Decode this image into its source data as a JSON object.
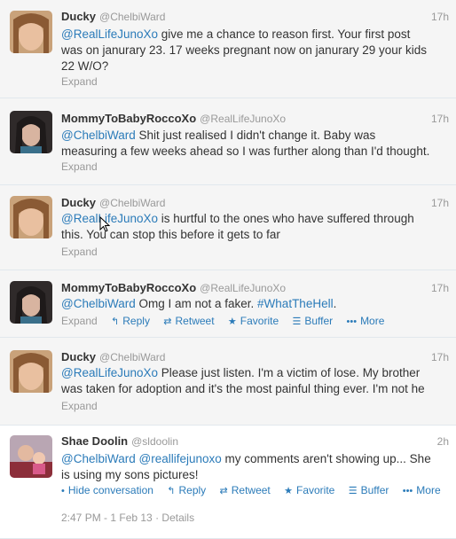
{
  "tweets": [
    {
      "name": "Ducky",
      "handle": "@ChelbiWard",
      "time": "17h",
      "mention": "@RealLifeJunoXo",
      "line1_rest": " give me a chance to reason first. Your first post",
      "line2": "was on janurary 23. 17 weeks pregnant now on janurary 29 your kids",
      "line3": "22 W/O?",
      "expand": "Expand"
    },
    {
      "name": "MommyToBabyRoccoXo",
      "handle": "@RealLifeJunoXo",
      "time": "17h",
      "mention": "@ChelbiWard",
      "line1_rest": " Shit just realised I didn't change it. Baby was",
      "line2": "measuring a few weeks ahead so I was further along than I'd thought.",
      "expand": "Expand"
    },
    {
      "name": "Ducky",
      "handle": "@ChelbiWard",
      "time": "17h",
      "mention": "@RealLifeJunoXo",
      "line1_rest": " is hurtful to the ones who have suffered through",
      "line2": "this. You can stop this before it gets to far",
      "expand": "Expand"
    },
    {
      "name": "MommyToBabyRoccoXo",
      "handle": "@RealLifeJunoXo",
      "time": "17h",
      "mention": "@ChelbiWard",
      "line1_middle": " Omg I am not a faker. ",
      "hashtag": "#WhatTheHell",
      "line1_end": ".",
      "actions": {
        "expand": "Expand",
        "reply": "Reply",
        "retweet": "Retweet",
        "favorite": "Favorite",
        "buffer": "Buffer",
        "more": "More"
      }
    },
    {
      "name": "Ducky",
      "handle": "@ChelbiWard",
      "time": "17h",
      "mention": "@RealLifeJunoXo",
      "line1_rest": " Please just listen. I'm a victim of lose. My brother",
      "line2": "was taken for adoption and it's the most painful thing ever. I'm not he",
      "expand": "Expand"
    },
    {
      "name": "Shae Doolin",
      "handle": "@sldoolin",
      "time": "2h",
      "mention": "@ChelbiWard",
      "mention2": "@reallifejunoxo",
      "line1_rest": " my comments aren't showing up... She",
      "line2": "is using my sons pictures!",
      "actions": {
        "hide": "Hide conversation",
        "reply": "Reply",
        "retweet": "Retweet",
        "favorite": "Favorite",
        "buffer": "Buffer",
        "more": "More"
      },
      "timestamp": "2:47 PM - 1 Feb 13",
      "separator": "·",
      "details": "Details"
    }
  ],
  "colors": {
    "link": "#2b7bb9",
    "muted": "#999999",
    "row_bg": "#f5f5f5"
  }
}
